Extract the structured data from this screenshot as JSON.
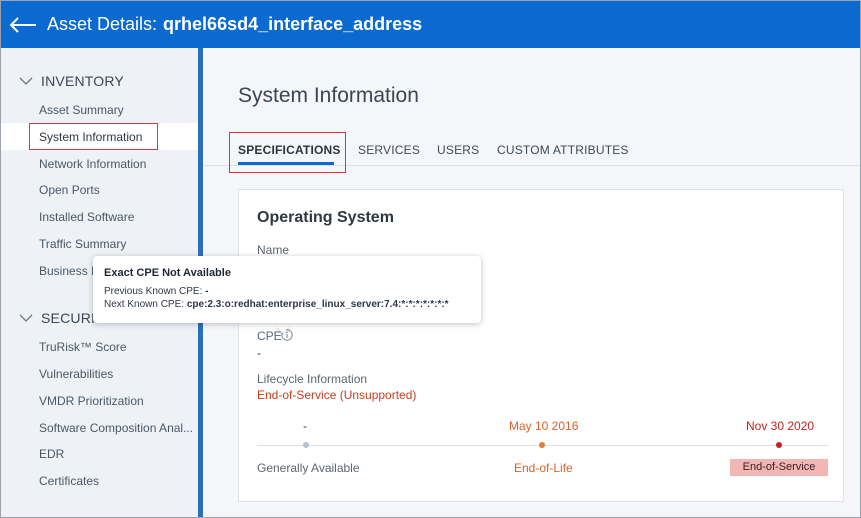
{
  "header": {
    "title_prefix": "Asset Details:",
    "asset_name": "qrhel66sd4_interface_address"
  },
  "sidebar": {
    "sections": [
      {
        "title": "INVENTORY",
        "items": [
          {
            "label": "Asset Summary"
          },
          {
            "label": "System Information",
            "active": true
          },
          {
            "label": "Network Information"
          },
          {
            "label": "Open Ports"
          },
          {
            "label": "Installed Software"
          },
          {
            "label": "Traffic Summary"
          },
          {
            "label": "Business I"
          }
        ]
      },
      {
        "title": "SECURITY",
        "items": [
          {
            "label": "TruRisk™ Score"
          },
          {
            "label": "Vulnerabilities"
          },
          {
            "label": "VMDR Prioritization"
          },
          {
            "label": "Software Composition Anal..."
          },
          {
            "label": "EDR"
          },
          {
            "label": "Certificates"
          }
        ]
      }
    ]
  },
  "main": {
    "page_title": "System Information",
    "tabs": [
      {
        "label": "SPECIFICATIONS",
        "active": true
      },
      {
        "label": "SERVICES"
      },
      {
        "label": "USERS"
      },
      {
        "label": "CUSTOM ATTRIBUTES"
      }
    ],
    "card": {
      "title": "Operating System",
      "name_label": "Name",
      "cpe_label": "CPE",
      "cpe_value": "-",
      "lifecycle_label": "Lifecycle Information",
      "lifecycle_status": "End-of-Service (Unsupported)",
      "timeline": [
        {
          "date": "-",
          "label": "Generally Available",
          "dot_color": "#b7c3cc",
          "date_color": "#2e3844",
          "label_color": "#5b6773"
        },
        {
          "date": "May 10 2016",
          "label": "End-of-Life",
          "dot_color": "#e07b39",
          "date_color": "#d9622b",
          "label_color": "#d9622b"
        },
        {
          "date": "Nov 30 2020",
          "label": "End-of-Service",
          "dot_color": "#c8201d",
          "date_color": "#c8201d",
          "label_color": "#3a2020"
        }
      ]
    }
  },
  "tooltip": {
    "title": "Exact CPE Not Available",
    "previous_label": "Previous Known CPE:",
    "previous_value": "-",
    "next_label": "Next Known CPE:",
    "next_value": "cpe:2.3:o:redhat:enterprise_linux_server:7.4:*:*:*:*:*:*:*"
  },
  "colors": {
    "header_bg": "#0a6ad0",
    "sidebar_bg": "#eef2f7",
    "highlight_red": "#d9363e",
    "status_red": "#cc3b1c"
  }
}
